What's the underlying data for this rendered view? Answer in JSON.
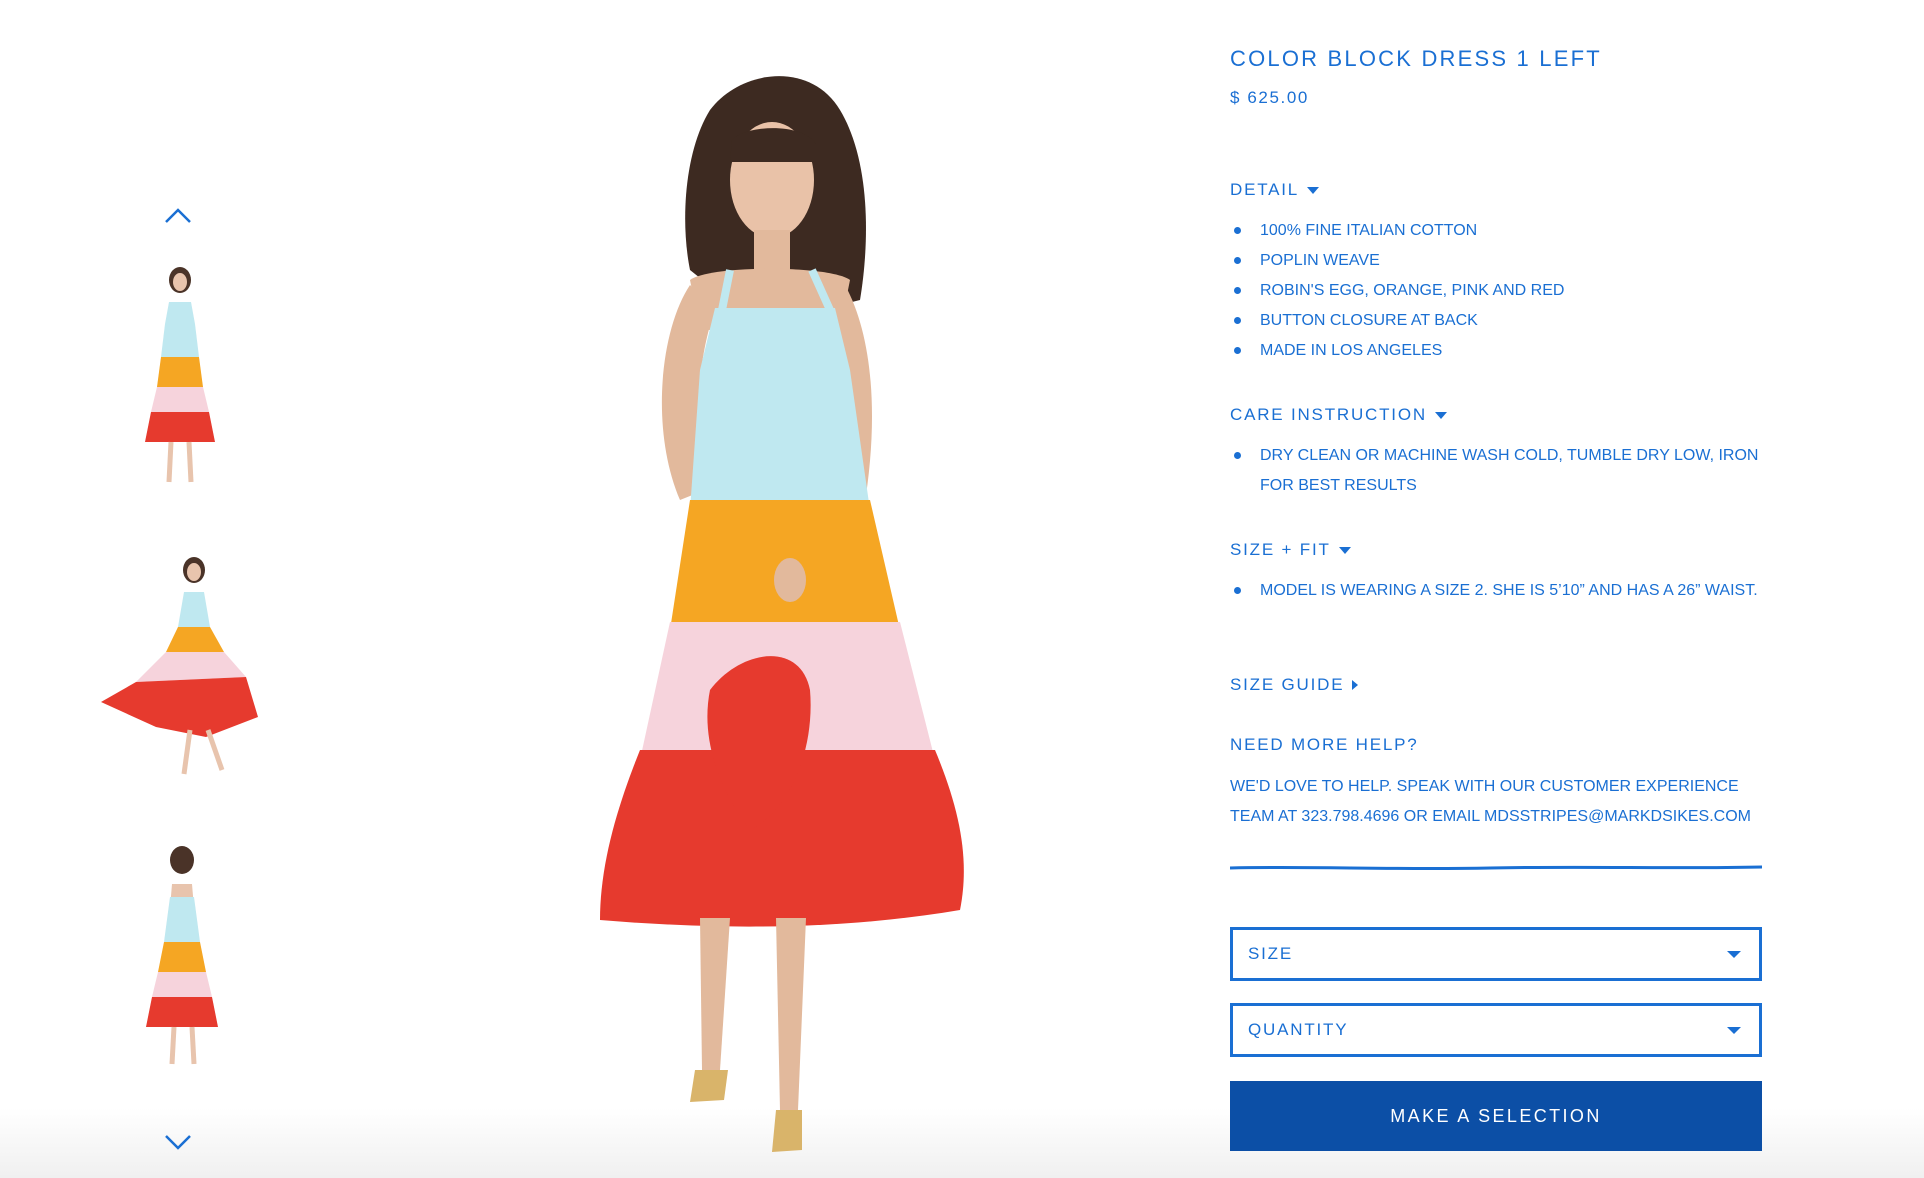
{
  "colors": {
    "accent": "#1a6fd3",
    "button_bg": "#0c4fa6",
    "button_text": "#ffffff",
    "dress_top": "#bfe8f0",
    "dress_orange": "#f5a623",
    "dress_pink": "#f6d3dc",
    "dress_red": "#e63a2e"
  },
  "gallery": {
    "prev_icon": "chevron-up-icon",
    "next_icon": "chevron-down-icon",
    "thumbnails": [
      "front-view",
      "twirl-view",
      "back-view"
    ]
  },
  "product": {
    "title": "COLOR BLOCK DRESS 1 LEFT",
    "price": "$ 625.00"
  },
  "detail": {
    "heading": "DETAIL",
    "items": [
      "100% Fine Italian Cotton",
      "Poplin Weave",
      "Robin's Egg, Orange, Pink and Red",
      "Button Closure at Back",
      "Made in Los Angeles"
    ]
  },
  "care": {
    "heading": "CARE INSTRUCTION",
    "items": [
      "Dry Clean or Machine Wash Cold, Tumble Dry Low, Iron for Best Results"
    ]
  },
  "fit": {
    "heading": "SIZE + FIT",
    "items": [
      "Model is wearing a size 2.  She is 5’10” and has a 26” waist."
    ]
  },
  "size_guide": {
    "label": "SIZE GUIDE"
  },
  "help": {
    "heading": "NEED MORE HELP?",
    "text": "We'd love to help. Speak with our customer experience team at 323.798.4696 or email mdsstripes@markdsikes.com"
  },
  "form": {
    "size_label": "SIZE",
    "quantity_label": "QUANTITY",
    "button_label": "MAKE A SELECTION"
  }
}
